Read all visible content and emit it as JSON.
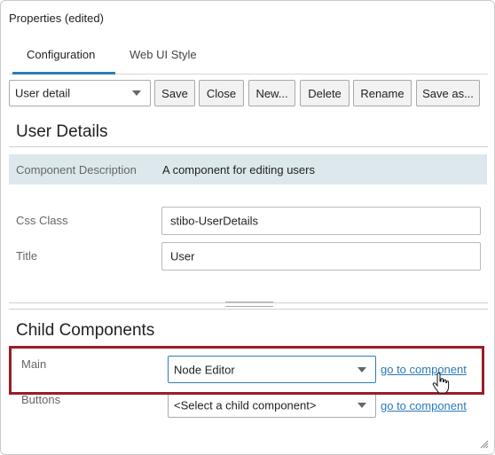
{
  "window": {
    "title": "Properties (edited)"
  },
  "tabs": [
    {
      "label": "Configuration",
      "active": true
    },
    {
      "label": "Web UI Style",
      "active": false
    }
  ],
  "toolbar": {
    "preset_select": "User detail",
    "buttons": [
      "Save",
      "Close",
      "New...",
      "Delete",
      "Rename",
      "Save as..."
    ]
  },
  "details": {
    "heading": "User Details",
    "description_label": "Component Description",
    "description_value": "A component for editing users",
    "css_class_label": "Css Class",
    "css_class_value": "stibo-UserDetails",
    "title_label": "Title",
    "title_value": "User"
  },
  "children": {
    "heading": "Child Components",
    "rows": [
      {
        "label": "Main",
        "value": "Node Editor",
        "link": "go to component"
      },
      {
        "label": "Buttons",
        "value": "<Select a child component>",
        "link": "go to component"
      }
    ]
  },
  "colors": {
    "accent": "#2c7fb8",
    "highlight": "#9b1c26",
    "description_bg": "#dde8ec",
    "link": "#2a7ab8"
  },
  "icons": [
    "chevron-down-icon",
    "hand-pointer-icon",
    "resize-grip-icon"
  ]
}
